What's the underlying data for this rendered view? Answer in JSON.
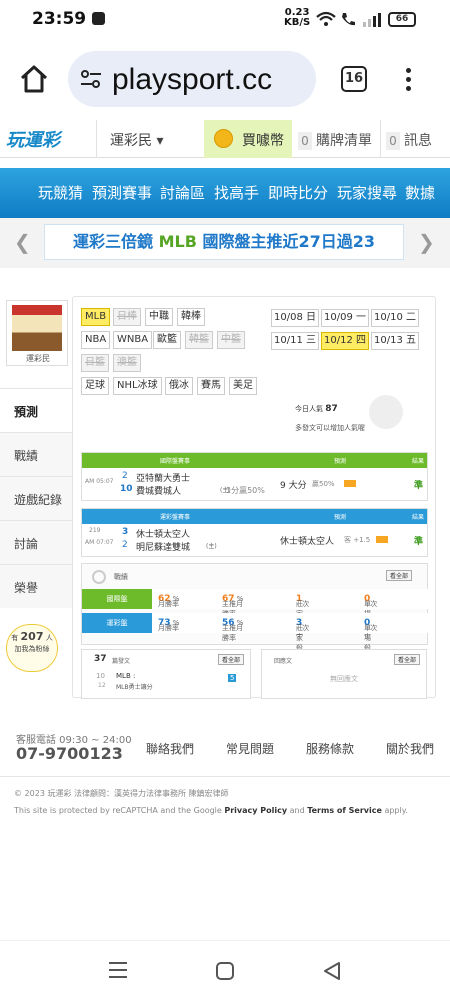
{
  "status_bar": {
    "time": "23:59",
    "speed_value": "0.23",
    "speed_unit": "KB/S",
    "battery": "66"
  },
  "browser": {
    "url": "playsport.cc",
    "tab_count": "16"
  },
  "site_nav": {
    "logo": "玩運彩",
    "member": "運彩民 ▾",
    "coin_label": "買噱幣",
    "cart_count": "0",
    "cart_label": "購牌清單",
    "msg_count": "0",
    "msg_label": "訊息"
  },
  "main_nav": {
    "items": [
      "玩競猜",
      "預測賽事",
      "討論區",
      "找高手",
      "即時比分",
      "玩家搜尋",
      "數據"
    ]
  },
  "banner": {
    "part1": "運彩三倍鏡 ",
    "part2": "MLB",
    "part3": " 國際盤主推近27日過23"
  },
  "profile": {
    "name": "運彩民"
  },
  "sidebar": {
    "items": [
      "預測",
      "戰績",
      "遊戲紀錄",
      "討論",
      "榮譽"
    ]
  },
  "fans": {
    "prefix": "有",
    "count": "207",
    "suffix": "人",
    "text": "加我為粉絲"
  },
  "sports": [
    {
      "label": "MLB",
      "state": "selected"
    },
    {
      "label": "日棒",
      "state": "off"
    },
    {
      "label": "中職",
      "state": "on"
    },
    {
      "label": "韓棒",
      "state": "on"
    },
    {
      "label": "NBA",
      "state": "on"
    },
    {
      "label": "WNBA",
      "state": "on"
    },
    {
      "label": "歐籃",
      "state": "on"
    },
    {
      "label": "韓籃",
      "state": "off"
    },
    {
      "label": "中籃",
      "state": "off"
    },
    {
      "label": "日籃",
      "state": "off"
    },
    {
      "label": "澳籃",
      "state": "off"
    },
    {
      "label": "足球",
      "state": "on"
    },
    {
      "label": "NHL冰球",
      "state": "on"
    },
    {
      "label": "俄冰",
      "state": "on"
    },
    {
      "label": "賽馬",
      "state": "on"
    },
    {
      "label": "美足",
      "state": "on"
    }
  ],
  "dates": [
    {
      "label": "10/08 日",
      "selected": false
    },
    {
      "label": "10/09 一",
      "selected": false
    },
    {
      "label": "10/10 二",
      "selected": false
    },
    {
      "label": "10/11 三",
      "selected": false
    },
    {
      "label": "10/12 四",
      "selected": true
    },
    {
      "label": "10/13 五",
      "selected": false
    }
  ],
  "popularity": {
    "label": "今日人氣",
    "value": "87",
    "note": "多發文可以增加人氣喔"
  },
  "intl_table": {
    "headers": [
      "國際盤賽事",
      "預測",
      "結果"
    ],
    "row": {
      "time": "AM 05:07",
      "team1_num": "2",
      "team1": "亞特蘭大勇士",
      "team2_num": "10",
      "team2": "費城費城人",
      "team2_tag": "(主)",
      "line": "1分贏50%",
      "pick": "9 大分",
      "pick_note": "贏50%",
      "result": "準"
    }
  },
  "local_table": {
    "headers": [
      "運彩盤賽事",
      "預測",
      "結果"
    ],
    "row": {
      "game_no": "219",
      "time": "AM 07:07",
      "team1_num": "3",
      "team1": "休士頓太空人",
      "team2_num": "2",
      "team2": "明尼蘇達雙城",
      "team2_tag": "(主)",
      "pick": "休士頓太空人",
      "pick_note": "客 +1.5",
      "result": "準"
    }
  },
  "stats": {
    "title": "戰績",
    "see_all": "看全部",
    "rows": [
      {
        "tag": "國際盤",
        "win_label": "月勝率",
        "win": "62",
        "main_label": "主推月勝率",
        "main": "67",
        "home_label": "莊家殺手",
        "home": "1",
        "single_label": "單場殺手",
        "single": "0",
        "unit": "次"
      },
      {
        "tag": "運彩盤",
        "win_label": "月勝率",
        "win": "73",
        "main_label": "主推月勝率",
        "main": "56",
        "home_label": "莊家殺手",
        "home": "3",
        "single_label": "單場殺手",
        "single": "0",
        "unit": "次"
      }
    ]
  },
  "posts": {
    "count": "37",
    "label": "篇發文",
    "see_all": "看全部",
    "date_m": "10",
    "date_d": "12",
    "line1": "MLB :",
    "line2": "MLB勇士讓分",
    "tag": "5"
  },
  "replies": {
    "label": "回應文",
    "see_all": "看全部",
    "empty": "無回應文"
  },
  "footer": {
    "phone_label": "客服電話 09:30 ~ 24:00",
    "phone": "07-9700123",
    "links": [
      "聯絡我們",
      "常見問題",
      "服務條款",
      "關於我們"
    ],
    "copyright": "© 2023 玩運彩 法律顧問：漢英得力法律事務所 陳鎮宏律師",
    "recaptcha_pre": "This site is protected by reCAPTCHA and the Google ",
    "privacy": "Privacy Policy",
    "and": " and ",
    "terms": "Terms of Service",
    "apply": " apply."
  },
  "colors": {
    "brand_blue": "#1789c9",
    "green": "#57a524",
    "yellow": "#ffec63",
    "orange": "#f08020"
  }
}
